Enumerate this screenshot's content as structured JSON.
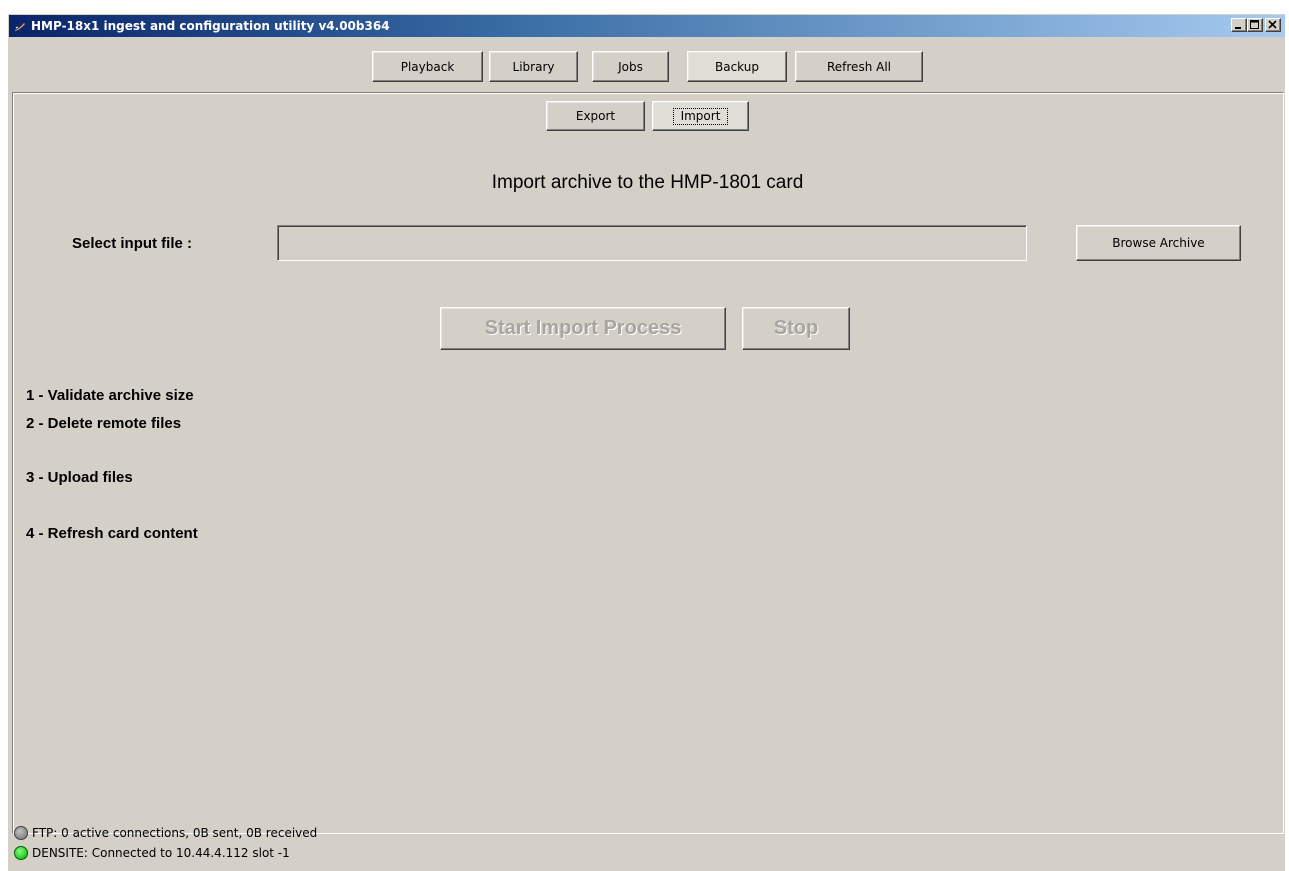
{
  "window": {
    "title": "HMP-18x1 ingest and configuration utility v4.00b364"
  },
  "top_tabs": [
    {
      "label": "Playback"
    },
    {
      "label": "Library"
    },
    {
      "label": "Jobs"
    },
    {
      "label": "Backup",
      "selected": true
    },
    {
      "label": "Refresh All"
    }
  ],
  "sub_tabs": [
    {
      "label": "Export"
    },
    {
      "label": "Import",
      "selected": true
    }
  ],
  "import": {
    "heading": "Import archive to the HMP-1801 card",
    "select_label": "Select input file :",
    "input_value": "",
    "browse_label": "Browse Archive",
    "start_label": "Start Import Process",
    "stop_label": "Stop"
  },
  "steps": [
    "1 - Validate archive size",
    "2 - Delete remote files",
    "3 - Upload files",
    "4 - Refresh card content"
  ],
  "status": {
    "ftp": {
      "text": "FTP: 0 active connections, 0B sent, 0B received",
      "color": "#808080"
    },
    "densite": {
      "text": "DENSITE: Connected to 10.44.4.112 slot -1",
      "color": "#00c000"
    }
  }
}
